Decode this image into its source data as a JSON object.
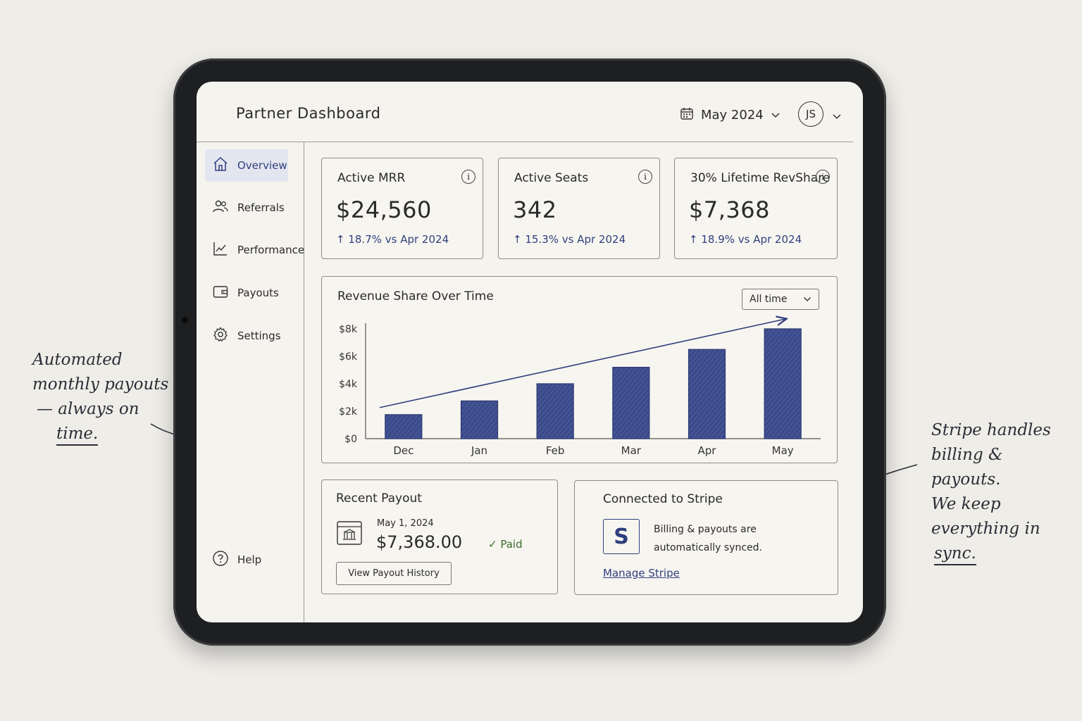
{
  "annotations": {
    "left": {
      "line1": "Automated",
      "line2": "monthly payouts",
      "line3": "— always on",
      "line4": "time."
    },
    "right": {
      "line1": "Stripe handles",
      "line2": "billing & payouts.",
      "line3": "We keep",
      "line4": "everything in",
      "line5": "sync."
    }
  },
  "header": {
    "title": "Partner Dashboard",
    "date": "May 2024",
    "avatar_initials": "JS"
  },
  "sidebar": {
    "items": [
      {
        "label": "Overview",
        "icon": "home-icon",
        "active": true
      },
      {
        "label": "Referrals",
        "icon": "users-icon"
      },
      {
        "label": "Performance",
        "icon": "line-chart-icon"
      },
      {
        "label": "Payouts",
        "icon": "wallet-icon"
      },
      {
        "label": "Settings",
        "icon": "gear-icon"
      }
    ],
    "help": "Help"
  },
  "kpis": [
    {
      "label": "Active MRR",
      "value": "$24,560",
      "delta": "↑ 18.7%  vs  Apr 2024"
    },
    {
      "label": "Active Seats",
      "value": "342",
      "delta": "↑ 15.3%  vs  Apr 2024"
    },
    {
      "label": "30% Lifetime RevShare",
      "value": "$7,368",
      "delta": "↑ 18.9%  vs  Apr 2024"
    }
  ],
  "chart_card": {
    "title": "Revenue Share Over Time",
    "range_select": "All time"
  },
  "chart_data": {
    "type": "bar",
    "title": "Revenue Share Over Time",
    "categories": [
      "Dec",
      "Jan",
      "Feb",
      "Mar",
      "Apr",
      "May"
    ],
    "values": [
      1750,
      2750,
      4000,
      5200,
      6500,
      8000
    ],
    "yticks": [
      "$0",
      "$2k",
      "$4k",
      "$6k",
      "$8k"
    ],
    "ylim": [
      0,
      8000
    ],
    "bar_color": "#3a4a8a",
    "trend_arrow": true,
    "grid": false
  },
  "recent_payout": {
    "title": "Recent Payout",
    "date": "May 1, 2024",
    "amount": "$7,368.00",
    "status": "✓ Paid",
    "button": "View Payout History"
  },
  "stripe": {
    "title": "Connected to Stripe",
    "logo_letter": "S",
    "text": "Billing & payouts are automatically synced.",
    "link": "Manage Stripe"
  },
  "colors": {
    "accent": "#2f3f7e",
    "paid": "#3b6b2e",
    "background": "#efede8"
  }
}
